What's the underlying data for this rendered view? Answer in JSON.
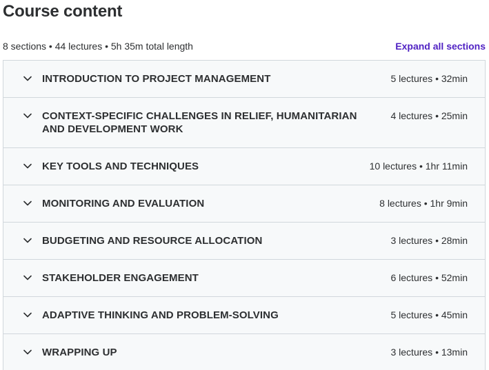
{
  "header": {
    "title": "Course content",
    "summary": "8 sections • 44 lectures • 5h 35m total length",
    "expand_all_label": "Expand all sections"
  },
  "colors": {
    "accent": "#5022c3",
    "section_bg": "#f7f9fa",
    "border": "#d1d7dc",
    "text": "#2d2f31"
  },
  "sections": [
    {
      "title": "INTRODUCTION TO PROJECT MANAGEMENT",
      "meta": "5 lectures • 32min",
      "icon": "chevron-down-icon"
    },
    {
      "title": "CONTEXT-SPECIFIC CHALLENGES IN RELIEF, HUMANITARIAN AND DEVELOPMENT WORK",
      "meta": "4 lectures • 25min",
      "icon": "chevron-down-icon"
    },
    {
      "title": "KEY TOOLS AND TECHNIQUES",
      "meta": "10 lectures • 1hr 11min",
      "icon": "chevron-down-icon"
    },
    {
      "title": "MONITORING AND EVALUATION",
      "meta": "8 lectures • 1hr 9min",
      "icon": "chevron-down-icon"
    },
    {
      "title": "BUDGETING AND RESOURCE ALLOCATION",
      "meta": "3 lectures • 28min",
      "icon": "chevron-down-icon"
    },
    {
      "title": "STAKEHOLDER ENGAGEMENT",
      "meta": "6 lectures • 52min",
      "icon": "chevron-down-icon"
    },
    {
      "title": "ADAPTIVE THINKING AND PROBLEM-SOLVING",
      "meta": "5 lectures • 45min",
      "icon": "chevron-down-icon"
    },
    {
      "title": "WRAPPING UP",
      "meta": "3 lectures • 13min",
      "icon": "chevron-down-icon"
    }
  ]
}
